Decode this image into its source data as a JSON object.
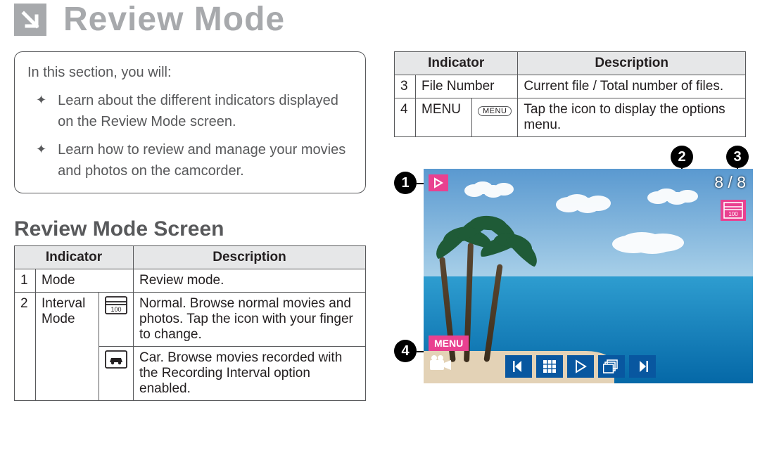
{
  "page": {
    "title": "Review Mode"
  },
  "intro": {
    "lead": "In this section, you will:",
    "bullets": [
      "Learn about the different indicators displayed on the Review Mode screen.",
      "Learn how to review and manage your movies and photos on the camcorder."
    ]
  },
  "section_heading": "Review Mode Screen",
  "table_headers": {
    "indicator": "Indicator",
    "description": "Description"
  },
  "left_table": {
    "row1": {
      "num": "1",
      "name": "Mode",
      "desc": "Review mode."
    },
    "row2": {
      "num": "2",
      "name": "Interval Mode",
      "normal_desc": "Normal. Browse normal movies and photos. Tap the icon with your finger to change.",
      "car_desc": "Car. Browse movies recorded with the Recording Interval option enabled."
    }
  },
  "right_table": {
    "row3": {
      "num": "3",
      "name": "File Number",
      "desc": "Current file / Total number of files."
    },
    "row4": {
      "num": "4",
      "name": "MENU",
      "icon_label": "MENU",
      "desc": "Tap the icon to display the options menu."
    }
  },
  "screen": {
    "file_counter": "8 / 8",
    "menu_label": "MENU",
    "callouts": {
      "c1": "1",
      "c2": "2",
      "c3": "3",
      "c4": "4"
    }
  },
  "interval_icon_label": "100"
}
